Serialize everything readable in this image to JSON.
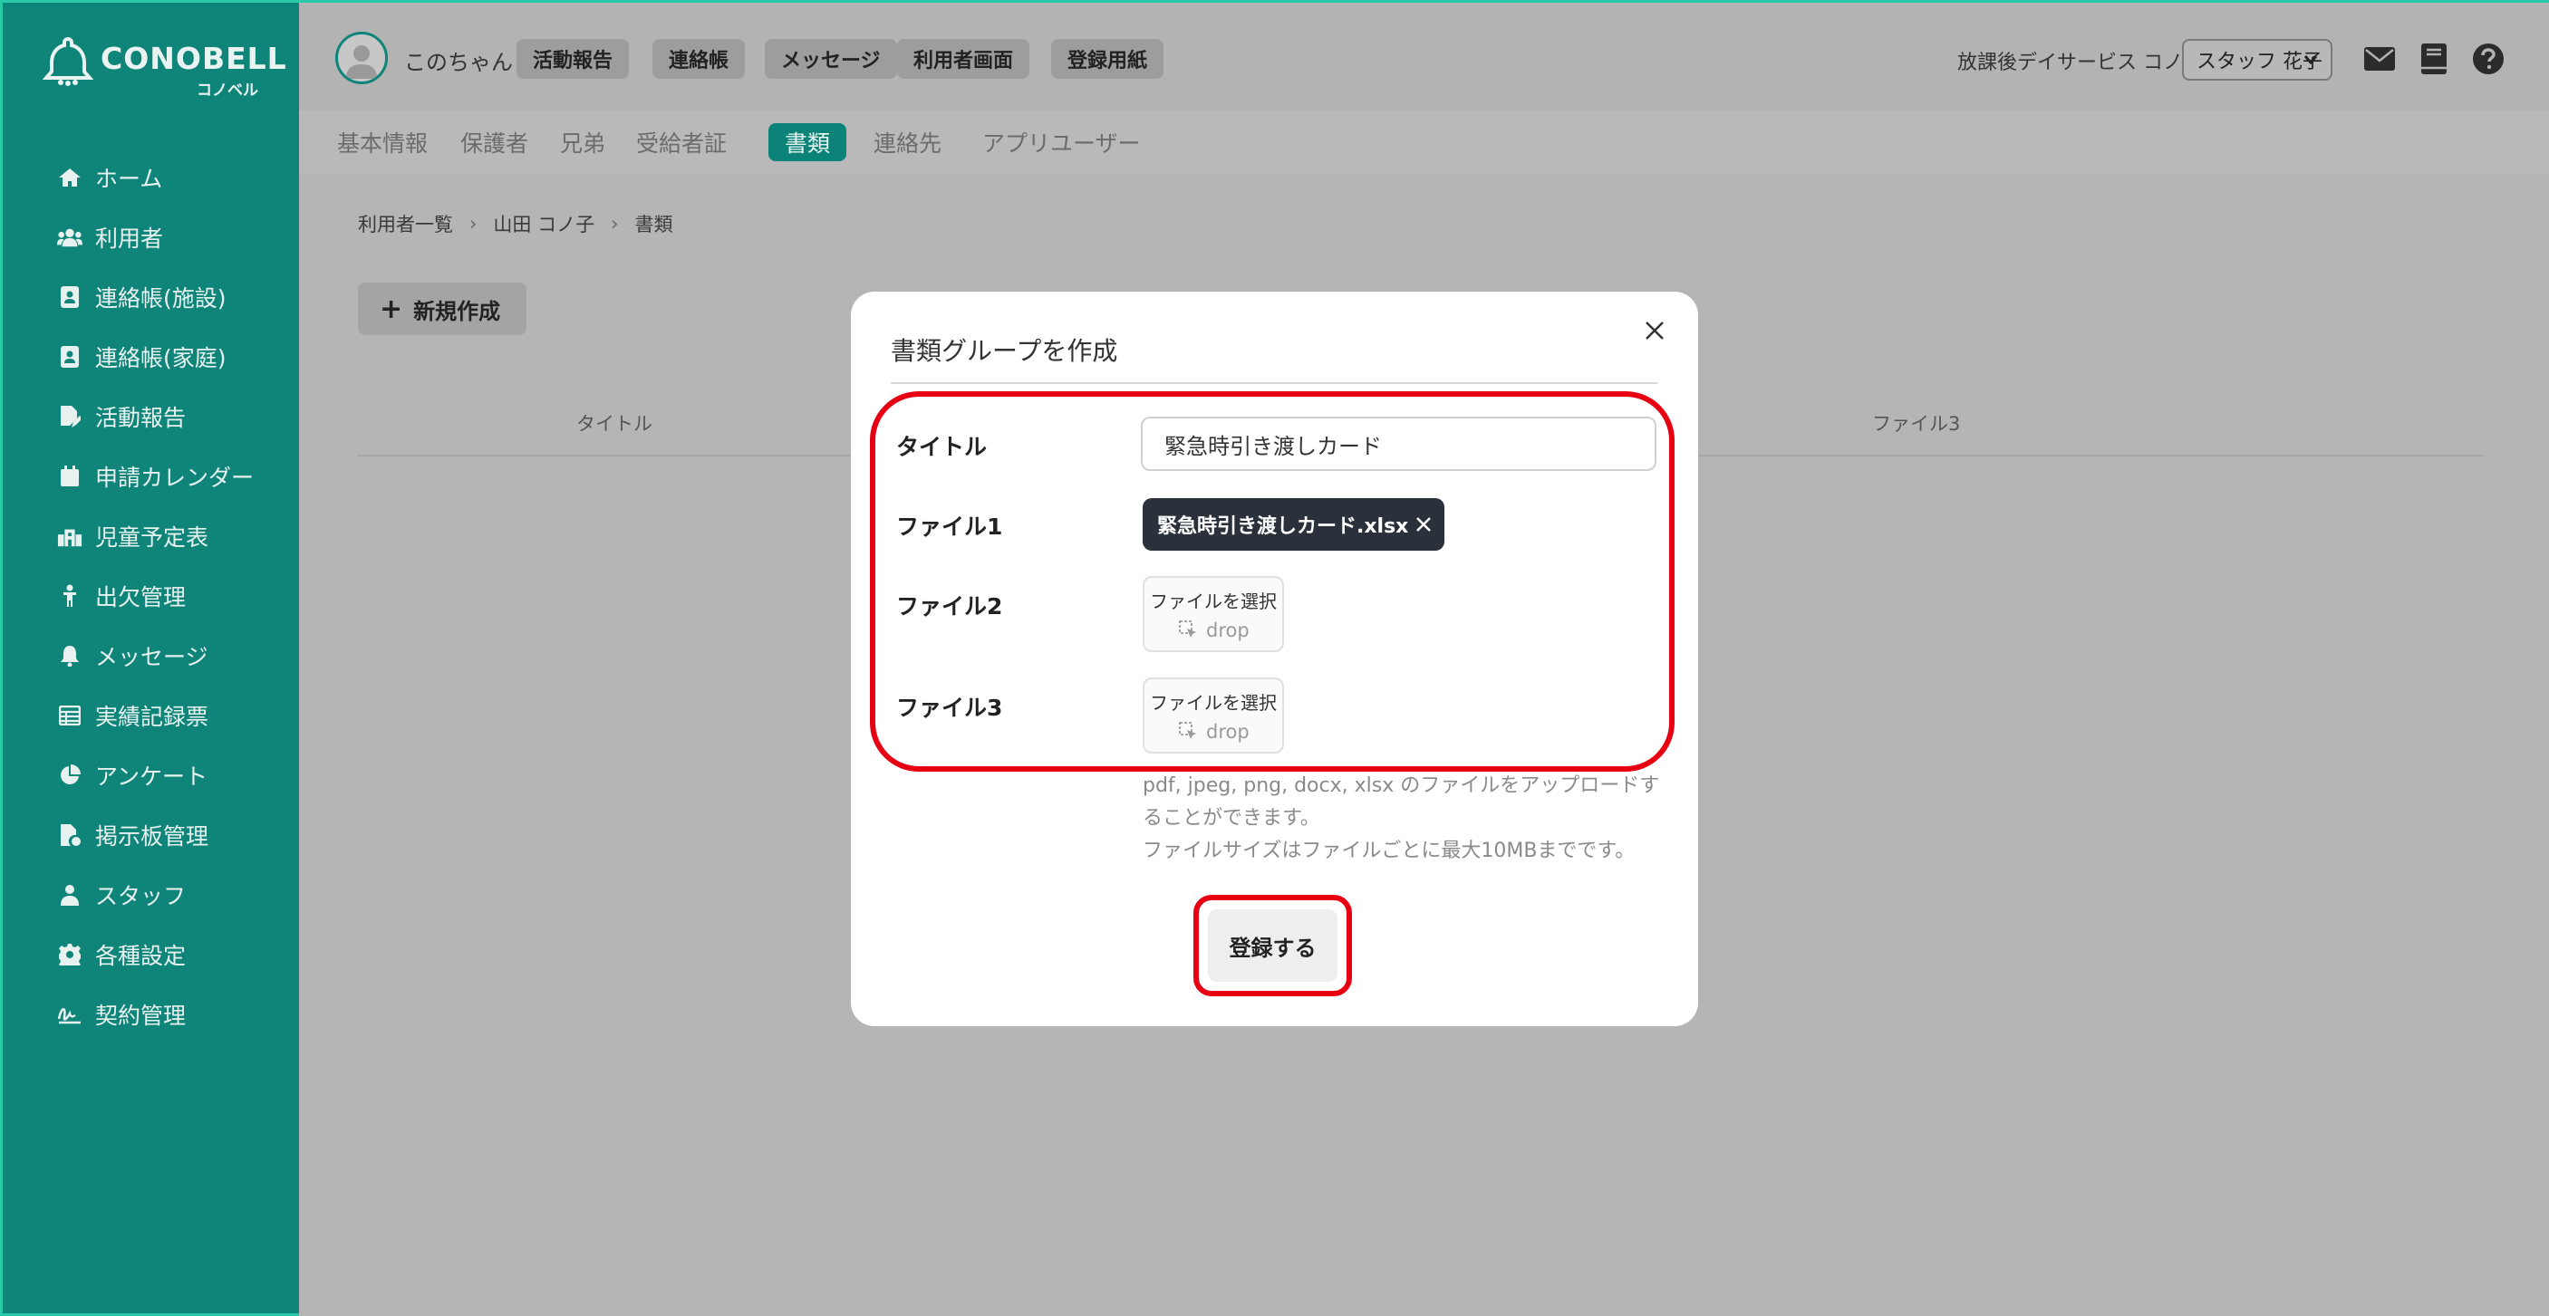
{
  "brand": {
    "name_en": "CONOBELL",
    "name_jp": "コノベル"
  },
  "sidebar": {
    "items": [
      {
        "label": "ホーム",
        "icon": "home-icon"
      },
      {
        "label": "利用者",
        "icon": "users-icon"
      },
      {
        "label": "連絡帳(施設)",
        "icon": "contact-book-icon"
      },
      {
        "label": "連絡帳(家庭)",
        "icon": "contact-book-icon"
      },
      {
        "label": "活動報告",
        "icon": "document-edit-icon"
      },
      {
        "label": "申請カレンダー",
        "icon": "calendar-icon"
      },
      {
        "label": "児童予定表",
        "icon": "building-icon"
      },
      {
        "label": "出欠管理",
        "icon": "person-icon"
      },
      {
        "label": "メッセージ",
        "icon": "bell-icon"
      },
      {
        "label": "実績記録票",
        "icon": "table-icon"
      },
      {
        "label": "アンケート",
        "icon": "pie-chart-icon"
      },
      {
        "label": "掲示板管理",
        "icon": "file-settings-icon"
      },
      {
        "label": "スタッフ",
        "icon": "staff-icon"
      },
      {
        "label": "各種設定",
        "icon": "gear-icon"
      },
      {
        "label": "契約管理",
        "icon": "signature-icon"
      }
    ]
  },
  "header": {
    "user_name": "このちゃん",
    "buttons": [
      "活動報告",
      "連絡帳",
      "メッセージ",
      "利用者画面",
      "登録用紙"
    ],
    "facility": "放課後デイサービス コノベル",
    "staff_select": "スタッフ 花子"
  },
  "tabs": [
    "基本情報",
    "保護者",
    "兄弟",
    "受給者証",
    "書類",
    "連絡先",
    "アプリユーザー"
  ],
  "active_tab": "書類",
  "breadcrumb": [
    "利用者一覧",
    "山田 コノ子",
    "書類"
  ],
  "new_button": "新規作成",
  "table": {
    "columns": [
      "タイトル",
      "ファイル3"
    ]
  },
  "modal": {
    "title": "書類グループを作成",
    "fields": {
      "title_label": "タイトル",
      "title_value": "緊急時引き渡しカード",
      "file1_label": "ファイル1",
      "file1_name": "緊急時引き渡しカード.xlsx",
      "file2_label": "ファイル2",
      "file3_label": "ファイル3",
      "file_pick_label": "ファイルを選択",
      "file_drop_label": "drop"
    },
    "note_line1": "pdf, jpeg, png, docx, xlsx のファイルをアップロードすることができます。",
    "note_line2": "ファイルサイズはファイルごとに最大10MBまでです。",
    "submit": "登録する"
  }
}
